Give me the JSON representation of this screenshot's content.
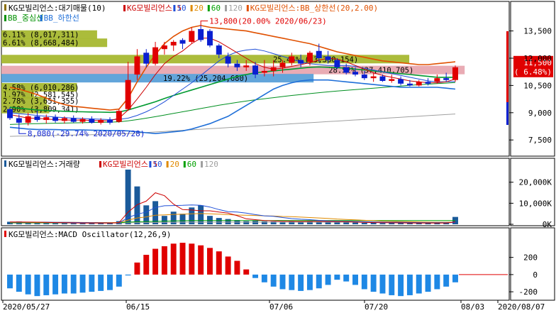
{
  "chart_data": [
    {
      "type": "candlestick",
      "panel": "price",
      "title": "KG모빌리언스:대기매물(10)",
      "legend": [
        {
          "label": "KG모빌리언스:5",
          "color": "#cc0000"
        },
        {
          "label": "10",
          "color": "#1f4fd8"
        },
        {
          "label": "20",
          "color": "#e08a00"
        },
        {
          "label": "60",
          "color": "#00a000"
        },
        {
          "label": "120",
          "color": "#a0a0a0"
        },
        {
          "label": "KG모빌리언스:BB_상한선(20,2.00)",
          "color": "#e05000"
        },
        {
          "label": "BB_중심선",
          "color": "#009000"
        },
        {
          "label": "BB_하한선",
          "color": "#1f6fd8"
        }
      ],
      "y_ticks": [
        "13,500",
        "12,000",
        "10,500",
        "9,000",
        "7,500"
      ],
      "ylim": [
        7000,
        14500
      ],
      "x_labels": [
        "2020/05/27",
        "06/15",
        "07/06",
        "07/20",
        "08/03",
        "2020/08/07"
      ],
      "current_price": {
        "value": "11,500",
        "change": "6.48%",
        "value_num": 11500
      },
      "annotations": {
        "high": "13,800(20.00% 2020/06/23)",
        "low": "8,080(-29.74% 2020/05/28)"
      },
      "volume_profile": [
        {
          "label": "6.11% (8,017,311)",
          "price": 13300,
          "width": 0.19
        },
        {
          "label": "6.61% (8,668,484)",
          "price": 12850,
          "width": 0.21
        },
        {
          "label": "25.45% (33,380,154)",
          "price": 11950,
          "width": 0.81
        },
        {
          "label": "28.52% (37,410,705)",
          "price": 11350,
          "width": 0.92
        },
        {
          "label": "19.22% (25,204,680)",
          "price": 10900,
          "width": 0.62
        },
        {
          "label": "4.58% (6,010,286)",
          "price": 10400,
          "width": 0.15
        },
        {
          "label": "1.97% (2,581,545)",
          "price": 10000,
          "width": 0.065
        },
        {
          "label": "2.78% (3,651,355)",
          "price": 9650,
          "width": 0.09
        },
        {
          "label": "2.90% (3,809,341)",
          "price": 9200,
          "width": 0.095
        }
      ],
      "candles": [
        {
          "o": 9200,
          "h": 9300,
          "l": 8600,
          "c": 8700
        },
        {
          "o": 8700,
          "h": 8900,
          "l": 8080,
          "c": 8450
        },
        {
          "o": 8450,
          "h": 9000,
          "l": 8300,
          "c": 8800
        },
        {
          "o": 8800,
          "h": 9100,
          "l": 8500,
          "c": 8600
        },
        {
          "o": 8600,
          "h": 8900,
          "l": 8400,
          "c": 8750
        },
        {
          "o": 8750,
          "h": 8900,
          "l": 8450,
          "c": 8550
        },
        {
          "o": 8550,
          "h": 8800,
          "l": 8400,
          "c": 8700
        },
        {
          "o": 8700,
          "h": 8850,
          "l": 8450,
          "c": 8500
        },
        {
          "o": 8500,
          "h": 8750,
          "l": 8400,
          "c": 8650
        },
        {
          "o": 8650,
          "h": 8800,
          "l": 8400,
          "c": 8450
        },
        {
          "o": 8450,
          "h": 8700,
          "l": 8350,
          "c": 8600
        },
        {
          "o": 8600,
          "h": 8750,
          "l": 8350,
          "c": 8450
        },
        {
          "o": 8500,
          "h": 9200,
          "l": 8450,
          "c": 9100
        },
        {
          "o": 9200,
          "h": 11800,
          "l": 9100,
          "c": 10800
        },
        {
          "o": 11100,
          "h": 12500,
          "l": 10800,
          "c": 12100
        },
        {
          "o": 12300,
          "h": 12500,
          "l": 11500,
          "c": 11700
        },
        {
          "o": 11700,
          "h": 12900,
          "l": 11600,
          "c": 12600
        },
        {
          "o": 12500,
          "h": 12900,
          "l": 12200,
          "c": 12700
        },
        {
          "o": 12700,
          "h": 13000,
          "l": 12400,
          "c": 12900
        },
        {
          "o": 13000,
          "h": 13100,
          "l": 12500,
          "c": 12800
        },
        {
          "o": 12900,
          "h": 13700,
          "l": 12800,
          "c": 13500
        },
        {
          "o": 13600,
          "h": 13800,
          "l": 12900,
          "c": 13000
        },
        {
          "o": 13500,
          "h": 13600,
          "l": 12600,
          "c": 12700
        },
        {
          "o": 12700,
          "h": 12800,
          "l": 12000,
          "c": 12200
        },
        {
          "o": 12100,
          "h": 12300,
          "l": 11500,
          "c": 11700
        },
        {
          "o": 11700,
          "h": 11900,
          "l": 11300,
          "c": 11500
        },
        {
          "o": 11500,
          "h": 11900,
          "l": 11300,
          "c": 11600
        },
        {
          "o": 11600,
          "h": 11800,
          "l": 10900,
          "c": 11100
        },
        {
          "o": 11200,
          "h": 11900,
          "l": 11000,
          "c": 11300
        },
        {
          "o": 11300,
          "h": 11900,
          "l": 11000,
          "c": 11500
        },
        {
          "o": 11500,
          "h": 11900,
          "l": 11200,
          "c": 11750
        },
        {
          "o": 11750,
          "h": 12300,
          "l": 11600,
          "c": 12100
        },
        {
          "o": 11900,
          "h": 12200,
          "l": 11500,
          "c": 11700
        },
        {
          "o": 11800,
          "h": 12400,
          "l": 11600,
          "c": 12300
        },
        {
          "o": 12400,
          "h": 12800,
          "l": 11800,
          "c": 12000
        },
        {
          "o": 12100,
          "h": 12400,
          "l": 11700,
          "c": 11900
        },
        {
          "o": 11900,
          "h": 12000,
          "l": 11400,
          "c": 11500
        },
        {
          "o": 11500,
          "h": 11700,
          "l": 11100,
          "c": 11200
        },
        {
          "o": 11250,
          "h": 11500,
          "l": 11000,
          "c": 11100
        },
        {
          "o": 11100,
          "h": 11300,
          "l": 10800,
          "c": 10900
        },
        {
          "o": 10900,
          "h": 11200,
          "l": 10700,
          "c": 11000
        },
        {
          "o": 11000,
          "h": 11100,
          "l": 10700,
          "c": 10750
        },
        {
          "o": 10750,
          "h": 11100,
          "l": 10650,
          "c": 10850
        },
        {
          "o": 10850,
          "h": 11000,
          "l": 10500,
          "c": 10600
        },
        {
          "o": 10600,
          "h": 10800,
          "l": 10450,
          "c": 10500
        },
        {
          "o": 10500,
          "h": 10800,
          "l": 10450,
          "c": 10700
        },
        {
          "o": 10700,
          "h": 10900,
          "l": 10500,
          "c": 10600
        },
        {
          "o": 10700,
          "h": 11100,
          "l": 10600,
          "c": 10900
        },
        {
          "o": 10900,
          "h": 11200,
          "l": 10700,
          "c": 10800
        },
        {
          "o": 10800,
          "h": 11600,
          "l": 10700,
          "c": 11500
        }
      ],
      "lines": {
        "ma5": [
          8900,
          8800,
          8700,
          8690,
          8650,
          8620,
          8600,
          8590,
          8600,
          8570,
          8560,
          8560,
          8700,
          9150,
          9750,
          10400,
          11100,
          11700,
          12100,
          12400,
          12800,
          13100,
          13100,
          12900,
          12600,
          12300,
          12000,
          11700,
          11500,
          11400,
          11450,
          11550,
          11650,
          11750,
          11900,
          12000,
          11950,
          11800,
          11600,
          11400,
          11200,
          11050,
          10950,
          10850,
          10750,
          10700,
          10650,
          10650,
          10700,
          10850
        ],
        "ma10": [
          9000,
          8950,
          8900,
          8850,
          8800,
          8760,
          8730,
          8700,
          8680,
          8660,
          8640,
          8620,
          8630,
          8700,
          8850,
          9050,
          9300,
          9600,
          9950,
          10300,
          10650,
          11050,
          11450,
          11850,
          12150,
          12350,
          12450,
          12500,
          12400,
          12250,
          12100,
          11950,
          11800,
          11700,
          11650,
          11600,
          11600,
          11600,
          11550,
          11450,
          11350,
          11250,
          11150,
          11050,
          10950,
          10850,
          10750,
          10700,
          10700,
          10720
        ],
        "bb_upper": [
          10400,
          10300,
          10150,
          10000,
          9800,
          9600,
          9450,
          9350,
          9300,
          9250,
          9200,
          9150,
          9200,
          9800,
          10700,
          11500,
          12200,
          12800,
          13200,
          13500,
          13700,
          13800,
          13700,
          13650,
          13600,
          13550,
          13500,
          13400,
          13300,
          13200,
          13100,
          13000,
          12900,
          12800,
          12650,
          12500,
          12350,
          12250,
          12150,
          12050,
          11950,
          11850,
          11800,
          11750,
          11700,
          11650,
          11650,
          11700,
          11750,
          11800
        ],
        "bb_middle": [
          9300,
          9250,
          9200,
          9150,
          9120,
          9100,
          9080,
          9060,
          9050,
          9040,
          9030,
          9020,
          9040,
          9150,
          9300,
          9450,
          9600,
          9780,
          9950,
          10100,
          10250,
          10400,
          10550,
          10700,
          10850,
          11000,
          11100,
          11200,
          11250,
          11300,
          11350,
          11400,
          11450,
          11500,
          11520,
          11500,
          11480,
          11450,
          11400,
          11350,
          11300,
          11250,
          11200,
          11150,
          11100,
          11050,
          11000,
          10950,
          10950,
          10950
        ],
        "bb_lower": [
          8200,
          8150,
          8100,
          8080,
          8080,
          8070,
          8060,
          8050,
          8050,
          8040,
          8030,
          8020,
          8020,
          8000,
          7950,
          7900,
          7850,
          7900,
          7950,
          8000,
          8100,
          8250,
          8400,
          8600,
          8800,
          9100,
          9400,
          9700,
          10000,
          10300,
          10500,
          10650,
          10750,
          10800,
          10800,
          10800,
          10750,
          10700,
          10650,
          10600,
          10550,
          10500,
          10450,
          10400,
          10400,
          10400,
          10400,
          10400,
          10350,
          10300
        ],
        "ma60": [
          8350,
          8370,
          8390,
          8400,
          8410,
          8420,
          8430,
          8440,
          8450,
          8460,
          8470,
          8480,
          8500,
          8550,
          8620,
          8700,
          8780,
          8870,
          8960,
          9050,
          9140,
          9230,
          9320,
          9410,
          9490,
          9570,
          9640,
          9710,
          9770,
          9830,
          9890,
          9950,
          10000,
          10050,
          10100,
          10150,
          10190,
          10230,
          10270,
          10310,
          10350,
          10390,
          10430,
          10470,
          10510,
          10540,
          10570,
          10600,
          10630,
          10660
        ],
        "ma120": [
          7700,
          7710,
          7720,
          7730,
          7740,
          7750,
          7760,
          7770,
          7780,
          7790,
          7800,
          7810,
          7830,
          7850,
          7880,
          7910,
          7940,
          7970,
          8000,
          8030,
          8060,
          8090,
          8120,
          8150,
          8180,
          8210,
          8240,
          8270,
          8300,
          8330,
          8360,
          8390,
          8420,
          8450,
          8480,
          8510,
          8540,
          8570,
          8600,
          8630,
          8660,
          8690,
          8720,
          8750,
          8780,
          8810,
          8840,
          8870,
          8900,
          8930
        ]
      }
    },
    {
      "type": "bar",
      "panel": "volume",
      "title": "KG모빌리언스:거래량",
      "legend": [
        {
          "label": "KG모빌리언스:5",
          "color": "#cc0000"
        },
        {
          "label": "10",
          "color": "#1f4fd8"
        },
        {
          "label": "20",
          "color": "#e08a00"
        },
        {
          "label": "60",
          "color": "#00a000"
        },
        {
          "label": "120",
          "color": "#a0a0a0"
        }
      ],
      "y_ticks": [
        "20,000K",
        "10,000K",
        "0K"
      ],
      "ylim": [
        0,
        27000
      ],
      "values": [
        1200,
        1300,
        900,
        800,
        700,
        600,
        700,
        600,
        500,
        500,
        600,
        500,
        1500,
        26000,
        18000,
        9000,
        11000,
        4000,
        6000,
        5000,
        8000,
        9000,
        4000,
        3000,
        2500,
        2000,
        1500,
        1800,
        1400,
        1300,
        1200,
        1500,
        1300,
        1600,
        1400,
        1200,
        1000,
        900,
        800,
        700,
        700,
        600,
        700,
        600,
        500,
        600,
        500,
        600,
        700,
        3500
      ],
      "ma5": [
        1100,
        1100,
        1050,
        1000,
        900,
        820,
        740,
        680,
        600,
        580,
        580,
        560,
        760,
        5800,
        9300,
        11000,
        15000,
        13600,
        9600,
        7000,
        6800,
        6400,
        6400,
        5800,
        5300,
        4100,
        2600,
        2200,
        1800,
        1600,
        1440,
        1440,
        1340,
        1380,
        1400,
        1360,
        1300,
        1200,
        1060,
        920,
        820,
        740,
        700,
        660,
        620,
        600,
        580,
        560,
        580,
        1160
      ],
      "ma10": [
        1000,
        1000,
        1000,
        1000,
        1000,
        960,
        920,
        880,
        800,
        740,
        700,
        680,
        680,
        3200,
        4800,
        5800,
        8000,
        8800,
        8900,
        9000,
        9200,
        9000,
        8200,
        7000,
        6000,
        5800,
        5300,
        4600,
        4000,
        3800,
        3200,
        2700,
        2400,
        2200,
        1850,
        1600,
        1500,
        1400,
        1300,
        1200,
        1100,
        1000,
        950,
        900,
        850,
        800,
        780,
        770,
        750,
        800
      ],
      "ma20": [
        900,
        900,
        900,
        900,
        900,
        900,
        900,
        900,
        880,
        860,
        840,
        820,
        800,
        2000,
        3000,
        3500,
        4300,
        4500,
        4700,
        4800,
        5000,
        5100,
        5000,
        4800,
        4600,
        4400,
        4300,
        4200,
        4000,
        3900,
        3700,
        3600,
        3400,
        3200,
        3000,
        2800,
        2500,
        2300,
        2100,
        1900,
        1700,
        1500,
        1400,
        1300,
        1200,
        1100,
        1000,
        950,
        900,
        950
      ],
      "ma60": [
        700,
        700,
        700,
        700,
        700,
        700,
        700,
        700,
        700,
        700,
        700,
        700,
        750,
        1000,
        1200,
        1300,
        1400,
        1500,
        1600,
        1700,
        1750,
        1800,
        1800,
        1800,
        1800,
        1800,
        1800,
        1800,
        1800,
        1800,
        1800,
        1800,
        1800,
        1800,
        1800,
        1800,
        1800,
        1800,
        1800,
        1800,
        1800,
        1800,
        1800,
        1800,
        1800,
        1800,
        1800,
        1800,
        1800,
        1800
      ],
      "ma120": [
        600,
        600,
        600,
        600,
        600,
        600,
        600,
        600,
        600,
        600,
        600,
        600,
        620,
        700,
        750,
        800,
        850,
        900,
        950,
        1000,
        1000,
        1000,
        1000,
        1000,
        1000,
        1000,
        1000,
        1000,
        1000,
        1000,
        1000,
        1000,
        1000,
        1000,
        1000,
        1000,
        1000,
        1000,
        1000,
        1000,
        1000,
        1000,
        1000,
        1000,
        1000,
        1000,
        1000,
        1000,
        1000,
        1000
      ]
    },
    {
      "type": "bar",
      "panel": "macd",
      "title": "KG모빌리언스:MACD Oscillator(12,26,9)",
      "y_ticks": [
        "200",
        "0",
        "-200"
      ],
      "ylim": [
        -290,
        420
      ],
      "values": [
        -160,
        -200,
        -230,
        -250,
        -240,
        -230,
        -220,
        -220,
        -210,
        -200,
        -190,
        -180,
        -140,
        -10,
        140,
        230,
        300,
        330,
        360,
        370,
        360,
        340,
        310,
        270,
        210,
        160,
        60,
        -40,
        -90,
        -140,
        -170,
        -180,
        -190,
        -180,
        -160,
        -120,
        -60,
        -80,
        -120,
        -170,
        -200,
        -220,
        -240,
        -250,
        -240,
        -220,
        -200,
        -170,
        -140,
        -90
      ]
    }
  ]
}
